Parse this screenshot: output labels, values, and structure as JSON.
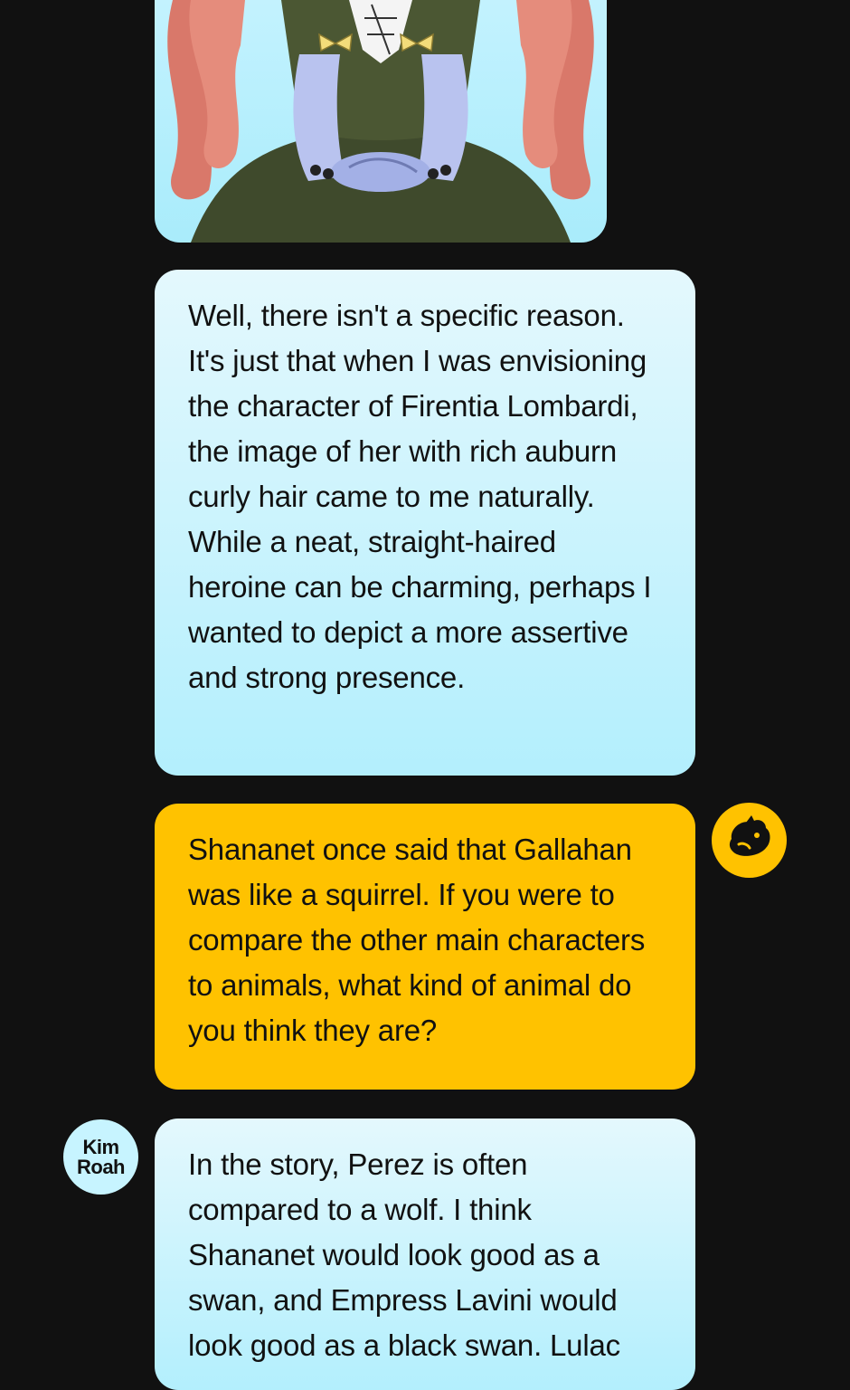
{
  "messages": [
    {
      "speaker": "author",
      "text": "Well, there isn't a specific reason. It's just that when I was envisioning the character of Firentia Lombardi, the image of her with rich auburn curly hair came to me naturally. While a neat, straight-haired heroine can be charming, perhaps I wanted to depict a more assertive and strong presence."
    },
    {
      "speaker": "interviewer",
      "text": "Shananet once said that Gallahan was like a squirrel. If you were to compare the other main characters to animals, what kind of animal do you think they are?"
    },
    {
      "speaker": "author",
      "text": "In the story, Perez is often compared to a wolf. I think Shananet would look good as a swan, and Empress Lavini would look good as a black swan. Lulac"
    }
  ],
  "author_avatar": {
    "line1": "Kim",
    "line2": "Roah"
  },
  "interviewer_avatar": {
    "icon": "mascot-icon"
  },
  "colors": {
    "background": "#111111",
    "question_bubble": "#ffc200",
    "answer_bubble_top": "#e4f8fd",
    "answer_bubble_bottom": "#b3effd",
    "text": "#111111"
  }
}
